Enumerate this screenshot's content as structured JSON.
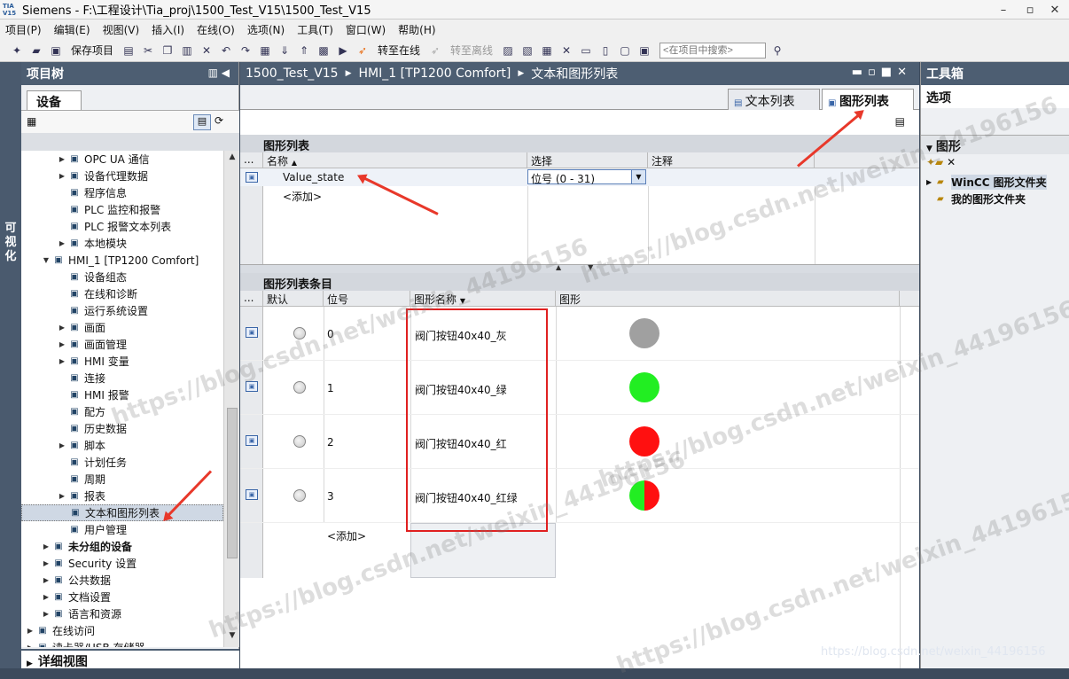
{
  "window": {
    "title": "Siemens  -  F:\\工程设计\\Tia_proj\\1500_Test_V15\\1500_Test_V15",
    "logo": "TIA V15"
  },
  "menu": [
    "项目(P)",
    "编辑(E)",
    "视图(V)",
    "插入(I)",
    "在线(O)",
    "选项(N)",
    "工具(T)",
    "窗口(W)",
    "帮助(H)"
  ],
  "toolbar": {
    "save": "保存项目",
    "go_online": "转至在线",
    "go_offline": "转至离线",
    "search_placeholder": "<在项目中搜索>"
  },
  "left_strip": "可视化",
  "project_tree": {
    "title": "项目树",
    "device_tab": "设备",
    "detail_view": "详细视图",
    "items": [
      {
        "label": "OPC UA 通信",
        "icon": "opc-icon",
        "arrow": true,
        "indent": 40
      },
      {
        "label": "设备代理数据",
        "icon": "proxy-icon",
        "arrow": true,
        "indent": 40
      },
      {
        "label": "程序信息",
        "icon": "info-icon",
        "arrow": false,
        "indent": 40
      },
      {
        "label": "PLC 监控和报警",
        "icon": "alarm-icon",
        "arrow": false,
        "indent": 40
      },
      {
        "label": "PLC 报警文本列表",
        "icon": "list-icon",
        "arrow": false,
        "indent": 40
      },
      {
        "label": "本地模块",
        "icon": "module-icon",
        "arrow": true,
        "indent": 40
      },
      {
        "label": "HMI_1 [TP1200 Comfort]",
        "icon": "hmi-icon",
        "arrow": true,
        "expanded": true,
        "indent": 22
      },
      {
        "label": "设备组态",
        "icon": "config-icon",
        "arrow": false,
        "indent": 40
      },
      {
        "label": "在线和诊断",
        "icon": "diag-icon",
        "arrow": false,
        "indent": 40
      },
      {
        "label": "运行系统设置",
        "icon": "settings-icon",
        "arrow": false,
        "indent": 40
      },
      {
        "label": "画面",
        "icon": "folder-icon",
        "arrow": true,
        "indent": 40
      },
      {
        "label": "画面管理",
        "icon": "folder-icon",
        "arrow": true,
        "indent": 40
      },
      {
        "label": "HMI 变量",
        "icon": "tag-icon",
        "arrow": true,
        "indent": 40
      },
      {
        "label": "连接",
        "icon": "connection-icon",
        "arrow": false,
        "indent": 40
      },
      {
        "label": "HMI 报警",
        "icon": "mail-icon",
        "arrow": false,
        "indent": 40
      },
      {
        "label": "配方",
        "icon": "recipe-icon",
        "arrow": false,
        "indent": 40
      },
      {
        "label": "历史数据",
        "icon": "archive-icon",
        "arrow": false,
        "indent": 40
      },
      {
        "label": "脚本",
        "icon": "script-icon",
        "arrow": true,
        "indent": 40
      },
      {
        "label": "计划任务",
        "icon": "task-icon",
        "arrow": false,
        "indent": 40
      },
      {
        "label": "周期",
        "icon": "cycle-icon",
        "arrow": false,
        "indent": 40
      },
      {
        "label": "报表",
        "icon": "report-icon",
        "arrow": true,
        "indent": 40
      },
      {
        "label": "文本和图形列表",
        "icon": "textgraphic-icon",
        "arrow": false,
        "selected": true,
        "indent": 40
      },
      {
        "label": "用户管理",
        "icon": "user-icon",
        "arrow": false,
        "indent": 40
      },
      {
        "label": "未分组的设备",
        "icon": "devices-icon",
        "arrow": true,
        "bold": true,
        "indent": 22
      },
      {
        "label": "Security 设置",
        "icon": "security-icon",
        "arrow": true,
        "indent": 22
      },
      {
        "label": "公共数据",
        "icon": "common-icon",
        "arrow": true,
        "indent": 22
      },
      {
        "label": "文档设置",
        "icon": "doc-icon",
        "arrow": true,
        "indent": 22
      },
      {
        "label": "语言和资源",
        "icon": "lang-icon",
        "arrow": true,
        "indent": 22
      },
      {
        "label": "在线访问",
        "icon": "online-icon",
        "arrow": true,
        "indent": 4
      },
      {
        "label": "读卡器/USB 存储器",
        "icon": "card-icon",
        "arrow": true,
        "indent": 4
      }
    ]
  },
  "editor": {
    "breadcrumb": [
      "1500_Test_V15",
      "HMI_1 [TP1200 Comfort]",
      "文本和图形列表"
    ],
    "tabs": [
      "文本列表",
      "图形列表"
    ],
    "graphic_lists": {
      "section_title": "图形列表",
      "columns": [
        "...",
        "名称",
        "选择",
        "注释"
      ],
      "rows": [
        {
          "name": "Value_state",
          "selection": "位号 (0 - 31)"
        }
      ],
      "add": "<添加>"
    },
    "entries": {
      "section_title": "图形列表条目",
      "columns": [
        "...",
        "默认",
        "位号",
        "图形名称",
        "图形"
      ],
      "rows": [
        {
          "bit": "0",
          "name": "阀门按钮40x40_灰",
          "color": "#a0a0a0",
          "type": "solid"
        },
        {
          "bit": "1",
          "name": "阀门按钮40x40_绿",
          "color": "#22ee22",
          "type": "solid"
        },
        {
          "bit": "2",
          "name": "阀门按钮40x40_红",
          "color": "#ff1010",
          "type": "solid"
        },
        {
          "bit": "3",
          "name": "阀门按钮40x40_红绿",
          "color": "#22ee22",
          "color2": "#ff1010",
          "type": "split"
        }
      ],
      "add": "<添加>"
    }
  },
  "toolbox": {
    "title": "工具箱",
    "options": "选项",
    "graphics_section": "图形",
    "items": [
      "WinCC 图形文件夹",
      "我的图形文件夹"
    ]
  },
  "watermark": "https://blog.csdn.net/weixin_44196156",
  "credit": "https://blog.csdn.net/weixin_44196156",
  "annotation_color": "#e02020"
}
